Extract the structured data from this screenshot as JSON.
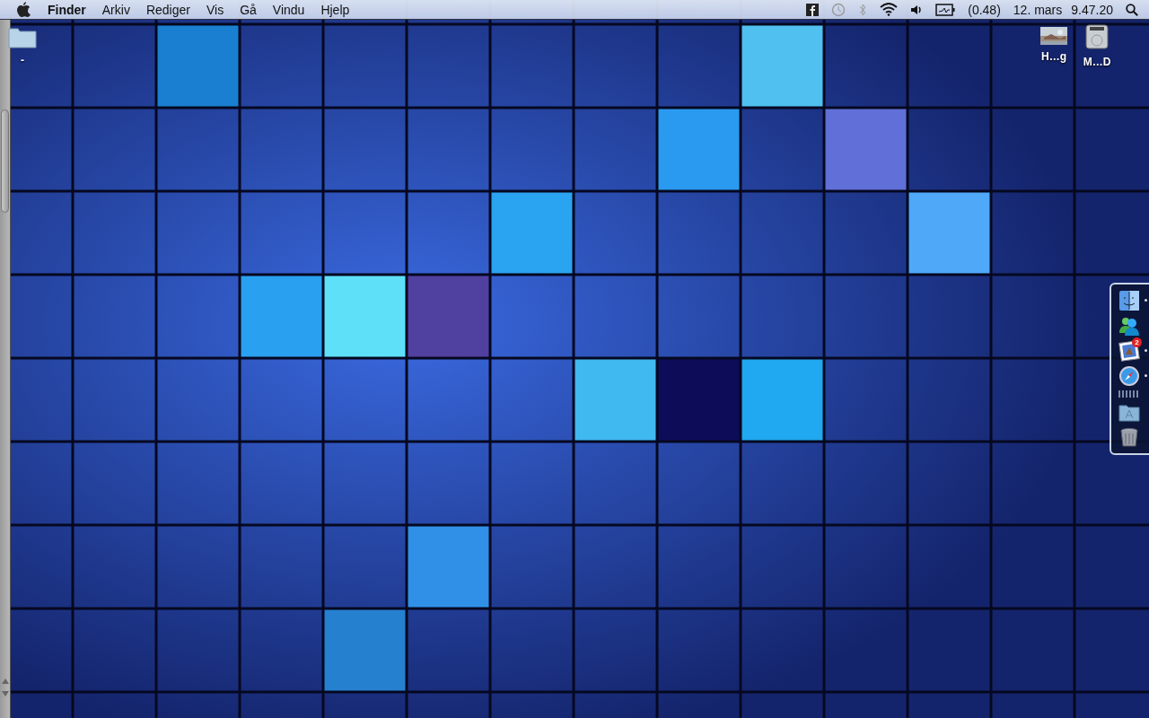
{
  "menu_bar": {
    "app_name": "Finder",
    "menus": [
      "Arkiv",
      "Rediger",
      "Vis",
      "Gå",
      "Vindu",
      "Hjelp"
    ],
    "load_reading": "(0.48)",
    "date": "12. mars",
    "time": "9.47.20"
  },
  "desktop_icons": [
    {
      "kind": "folder",
      "label": "-"
    },
    {
      "label": "H…g"
    },
    {
      "kind": "drive",
      "label": "M…D"
    }
  ],
  "dock": {
    "items": [
      {
        "kind": "finder",
        "running": true
      },
      {
        "kind": "people",
        "running": false
      },
      {
        "kind": "preview",
        "running": true,
        "badge": "2"
      },
      {
        "kind": "safari",
        "running": true
      },
      {
        "kind": "separator"
      },
      {
        "kind": "applications",
        "running": false
      },
      {
        "kind": "trash",
        "running": false
      }
    ]
  }
}
